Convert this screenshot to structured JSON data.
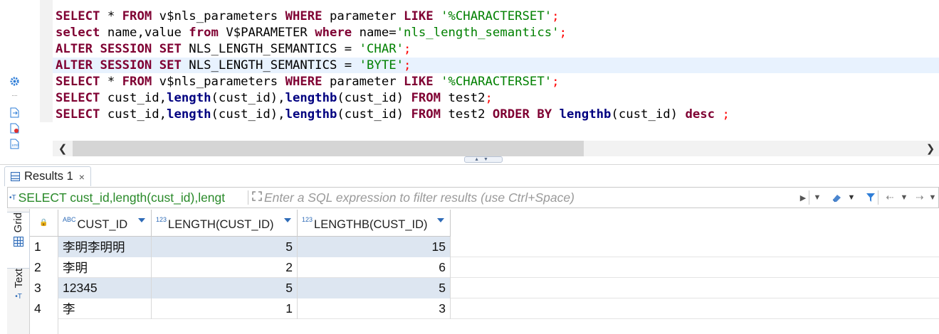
{
  "editor": {
    "lines": [
      [
        {
          "t": "SELECT",
          "c": "kw"
        },
        {
          "t": " * "
        },
        {
          "t": "FROM",
          "c": "kw"
        },
        {
          "t": " v$nls_parameters "
        },
        {
          "t": "WHERE",
          "c": "kw"
        },
        {
          "t": " parameter "
        },
        {
          "t": "LIKE",
          "c": "kw"
        },
        {
          "t": " "
        },
        {
          "t": "'%CHARACTERSET'",
          "c": "str"
        },
        {
          "t": ";",
          "c": "semi"
        }
      ],
      [
        {
          "t": "select",
          "c": "kw"
        },
        {
          "t": " name,value "
        },
        {
          "t": "from",
          "c": "kw"
        },
        {
          "t": " V$PARAMETER "
        },
        {
          "t": "where",
          "c": "kw"
        },
        {
          "t": " name="
        },
        {
          "t": "'nls_length_semantics'",
          "c": "str"
        },
        {
          "t": ";",
          "c": "semi"
        }
      ],
      [
        {
          "t": "ALTER",
          "c": "kw"
        },
        {
          "t": " "
        },
        {
          "t": "SESSION",
          "c": "kw"
        },
        {
          "t": " "
        },
        {
          "t": "SET",
          "c": "kw"
        },
        {
          "t": " NLS_LENGTH_SEMANTICS = "
        },
        {
          "t": "'CHAR'",
          "c": "str"
        },
        {
          "t": ";",
          "c": "semi"
        }
      ],
      [
        {
          "t": "ALTER",
          "c": "kw"
        },
        {
          "t": " "
        },
        {
          "t": "SESSION",
          "c": "kw"
        },
        {
          "t": " "
        },
        {
          "t": "SET",
          "c": "kw"
        },
        {
          "t": " NLS_LENGTH_SEMANTICS = "
        },
        {
          "t": "'BYTE'",
          "c": "str"
        },
        {
          "t": ";",
          "c": "semi"
        }
      ],
      [
        {
          "t": "SELECT",
          "c": "kw"
        },
        {
          "t": " * "
        },
        {
          "t": "FROM",
          "c": "kw"
        },
        {
          "t": " v$nls_parameters "
        },
        {
          "t": "WHERE",
          "c": "kw"
        },
        {
          "t": " parameter "
        },
        {
          "t": "LIKE",
          "c": "kw"
        },
        {
          "t": " "
        },
        {
          "t": "'%CHARACTERSET'",
          "c": "str"
        },
        {
          "t": ";",
          "c": "semi"
        }
      ],
      [
        {
          "t": "SELECT",
          "c": "kw"
        },
        {
          "t": " cust_id,"
        },
        {
          "t": "length",
          "c": "fn"
        },
        {
          "t": "(cust_id),"
        },
        {
          "t": "lengthb",
          "c": "fn"
        },
        {
          "t": "(cust_id) "
        },
        {
          "t": "FROM",
          "c": "kw"
        },
        {
          "t": " test2"
        },
        {
          "t": ";",
          "c": "semi"
        }
      ],
      [
        {
          "t": "SELECT",
          "c": "kw"
        },
        {
          "t": " cust_id,"
        },
        {
          "t": "length",
          "c": "fn"
        },
        {
          "t": "(cust_id),"
        },
        {
          "t": "lengthb",
          "c": "fn"
        },
        {
          "t": "(cust_id) "
        },
        {
          "t": "FROM",
          "c": "kw"
        },
        {
          "t": " test2 "
        },
        {
          "t": "ORDER",
          "c": "kw"
        },
        {
          "t": " "
        },
        {
          "t": "BY",
          "c": "kw"
        },
        {
          "t": " "
        },
        {
          "t": "lengthb",
          "c": "fn"
        },
        {
          "t": "(cust_id) "
        },
        {
          "t": "desc",
          "c": "kw"
        },
        {
          "t": " "
        },
        {
          "t": ";",
          "c": "semi"
        }
      ]
    ],
    "current_line": 4
  },
  "results": {
    "tab_label": "Results 1",
    "tab_close": "×",
    "filter_query": "SELECT cust_id,length(cust_id),lengt",
    "filter_placeholder": "Enter a SQL expression to filter results (use Ctrl+Space)",
    "side_tabs": {
      "grid": "Grid",
      "text": "Text"
    },
    "columns": [
      {
        "type": "ABC",
        "name": "CUST_ID"
      },
      {
        "type": "123",
        "name": "LENGTH(CUST_ID)"
      },
      {
        "type": "123",
        "name": "LENGTHB(CUST_ID)"
      }
    ],
    "rows": [
      {
        "n": "1",
        "cust_id": "李明李明明",
        "length": "5",
        "lengthb": "15"
      },
      {
        "n": "2",
        "cust_id": "李明",
        "length": "2",
        "lengthb": "6"
      },
      {
        "n": "3",
        "cust_id": "12345",
        "length": "5",
        "lengthb": "5"
      },
      {
        "n": "4",
        "cust_id": "李",
        "length": "1",
        "lengthb": "3"
      }
    ]
  },
  "icons": {
    "gutter": [
      "gear-icon",
      "dots-icon",
      "export-icon",
      "error-file-icon",
      "xml-file-icon"
    ],
    "toolbar": [
      "eraser-icon",
      "dropdown-icon",
      "filter-icon",
      "history-back-icon",
      "history-dropdown-icon",
      "history-forward-icon"
    ]
  },
  "colors": {
    "keyword": "#7f0032",
    "function": "#000080",
    "string": "#008000",
    "semicolon": "#ff0000",
    "current_line": "#e8f2fe",
    "row_alt": "#dde6f1"
  }
}
